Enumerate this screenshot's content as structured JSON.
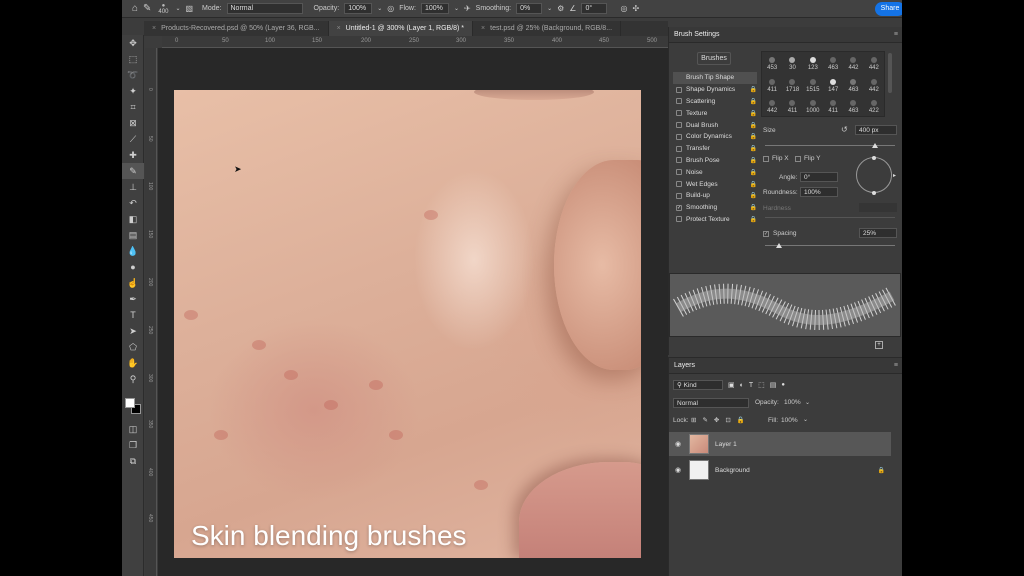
{
  "options_bar": {
    "brush_size": "400",
    "mode_label": "Mode:",
    "mode_value": "Normal",
    "opacity_label": "Opacity:",
    "opacity_value": "100%",
    "flow_label": "Flow:",
    "flow_value": "100%",
    "smoothing_label": "Smoothing:",
    "smoothing_value": "0%",
    "angle_value": "0°",
    "share_label": "Share"
  },
  "tabs": [
    {
      "label": "Products-Recovered.psd @ 50% (Layer 36, RGB..."
    },
    {
      "label": "Untitled-1 @ 300% (Layer 1, RGB/8) *"
    },
    {
      "label": "test.psd @ 25% (Background, RGB/8..."
    }
  ],
  "ruler": [
    "0",
    "50",
    "100",
    "150",
    "200",
    "250",
    "300",
    "350",
    "400",
    "450",
    "500"
  ],
  "canvas": {
    "caption": "Skin blending brushes"
  },
  "brush_settings": {
    "title": "Brush Settings",
    "brushes_button": "Brushes",
    "options": [
      {
        "label": "Brush Tip Shape",
        "checked": false,
        "lock": false
      },
      {
        "label": "Shape Dynamics",
        "checked": false,
        "lock": true
      },
      {
        "label": "Scattering",
        "checked": false,
        "lock": true
      },
      {
        "label": "Texture",
        "checked": false,
        "lock": true
      },
      {
        "label": "Dual Brush",
        "checked": false,
        "lock": true
      },
      {
        "label": "Color Dynamics",
        "checked": false,
        "lock": true
      },
      {
        "label": "Transfer",
        "checked": false,
        "lock": true
      },
      {
        "label": "Brush Pose",
        "checked": false,
        "lock": true
      },
      {
        "label": "Noise",
        "checked": false,
        "lock": true
      },
      {
        "label": "Wet Edges",
        "checked": false,
        "lock": true
      },
      {
        "label": "Build-up",
        "checked": false,
        "lock": true
      },
      {
        "label": "Smoothing",
        "checked": true,
        "lock": true
      },
      {
        "label": "Protect Texture",
        "checked": false,
        "lock": true
      }
    ],
    "tips": [
      "453",
      "30",
      "123",
      "463",
      "442",
      "442",
      "411",
      "1718",
      "1515",
      "147",
      "463",
      "442",
      "442",
      "411",
      "1000",
      "411",
      "463",
      "422"
    ],
    "size_label": "Size",
    "size_value": "400 px",
    "flipx_label": "Flip X",
    "flipy_label": "Flip Y",
    "angle_label": "Angle:",
    "angle_value": "0°",
    "roundness_label": "Roundness:",
    "roundness_value": "100%",
    "hardness_label": "Hardness",
    "spacing_label": "Spacing",
    "spacing_value": "25%"
  },
  "layers": {
    "title": "Layers",
    "filter_kind": "Kind",
    "blend_mode": "Normal",
    "opacity_label": "Opacity:",
    "opacity_value": "100%",
    "lock_label": "Lock:",
    "fill_label": "Fill:",
    "fill_value": "100%",
    "items": [
      {
        "name": "Layer 1"
      },
      {
        "name": "Background"
      }
    ]
  }
}
